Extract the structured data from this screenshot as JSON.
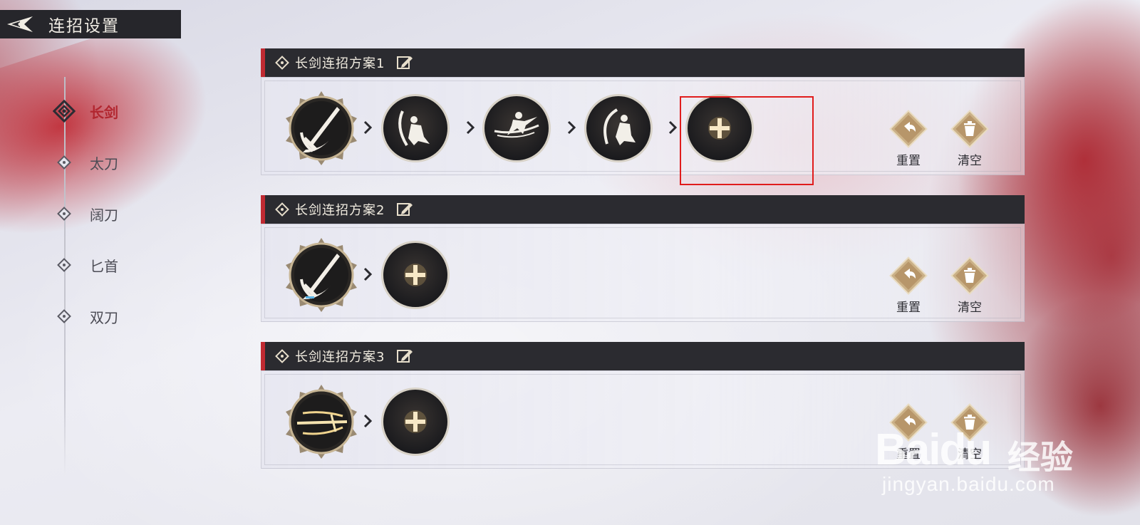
{
  "header": {
    "title": "连招设置"
  },
  "sidebar": {
    "items": [
      {
        "label": "长剑",
        "active": true
      },
      {
        "label": "太刀",
        "active": false
      },
      {
        "label": "阔刀",
        "active": false
      },
      {
        "label": "匕首",
        "active": false
      },
      {
        "label": "双刀",
        "active": false
      }
    ]
  },
  "combos": [
    {
      "title": "长剑连招方案1",
      "skills": [
        "weapon-longsword",
        "skill-crouch-slash",
        "skill-dash-strike",
        "skill-rising-slash",
        "add-slot"
      ]
    },
    {
      "title": "长剑连招方案2",
      "skills": [
        "weapon-longsword",
        "add-slot"
      ]
    },
    {
      "title": "长剑连招方案3",
      "skills": [
        "weapon-golden-sword",
        "add-slot"
      ]
    }
  ],
  "actions": {
    "reset_label": "重置",
    "clear_label": "清空"
  },
  "highlight": {
    "target": "combo-1 add-slot",
    "color": "#e01c1c"
  },
  "colors": {
    "accent_red": "#c02a32",
    "header_bg": "#2b2b30",
    "gold": "#c9a56a"
  },
  "watermark": {
    "logo": "Baidu",
    "cn": "经验",
    "url": "jingyan.baidu.com"
  }
}
